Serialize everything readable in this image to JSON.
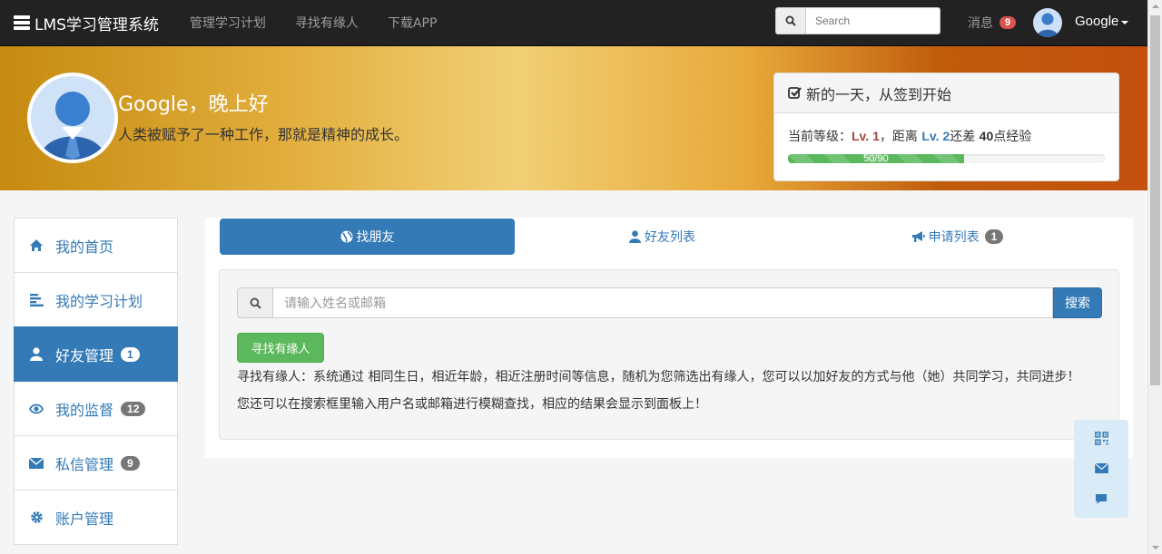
{
  "navbar": {
    "brand": "LMS学习管理系统",
    "links": [
      "管理学习计划",
      "寻找有缘人",
      "下载APP"
    ],
    "search_placeholder": "Search",
    "messages_label": "消息",
    "messages_count": "9",
    "user_name": "Google"
  },
  "banner": {
    "greeting": "Google，晚上好",
    "motto": "人类被赋予了一种工作，那就是精神的成长。",
    "checkin": {
      "title": "新的一天，从签到开始",
      "level_prefix": "当前等级：",
      "current_level": "Lv. 1",
      "level_mid": "，距离 ",
      "next_level": "Lv. 2",
      "level_mid2": "还差 ",
      "exp_needed": "40",
      "level_suffix": "点经验",
      "progress_label": "50/90",
      "progress_fraction": 0.5556
    }
  },
  "sidebar": {
    "items": [
      {
        "label": "我的首页",
        "icon": "home-icon",
        "badge": ""
      },
      {
        "label": "我的学习计划",
        "icon": "list-icon",
        "badge": ""
      },
      {
        "label": "好友管理",
        "icon": "user-icon",
        "badge": "1",
        "active": true
      },
      {
        "label": "我的监督",
        "icon": "eye-icon",
        "badge": "12"
      },
      {
        "label": "私信管理",
        "icon": "envelope-icon",
        "badge": "9"
      },
      {
        "label": "账户管理",
        "icon": "gear-icon",
        "badge": ""
      }
    ]
  },
  "main": {
    "tabs": [
      {
        "label": "找朋友",
        "icon": "globe-icon",
        "active": true
      },
      {
        "label": "好友列表",
        "icon": "user-icon"
      },
      {
        "label": "申请列表",
        "icon": "bullhorn-icon",
        "badge": "1"
      }
    ],
    "search_placeholder": "请输入姓名或邮箱",
    "search_button": "搜索",
    "find_button": "寻找有缘人",
    "description_1": "寻找有缘人：系统通过 相同生日，相近年龄，相近注册时间等信息，随机为您筛选出有缘人，您可以以加好友的方式与他（她）共同学习，共同进步！",
    "description_2": "您还可以在搜索框里输入用户名或邮箱进行模糊查找，相应的结果会显示到面板上！"
  },
  "floating_tools": [
    "qrcode-icon",
    "envelope-icon",
    "comment-icon"
  ],
  "colors": {
    "primary": "#337ab7",
    "success": "#5cb85c",
    "danger": "#d9534f",
    "navbar": "#222222"
  }
}
